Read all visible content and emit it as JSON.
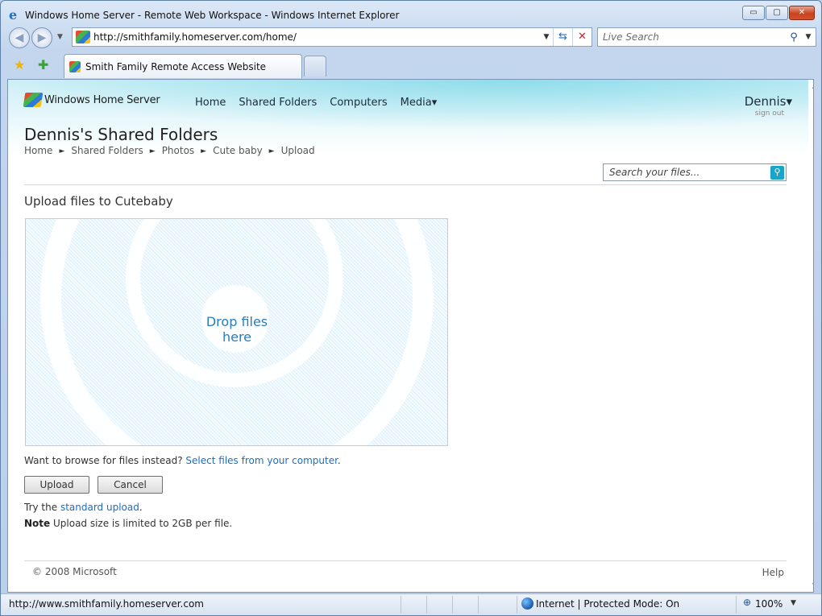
{
  "browser": {
    "window_title": "Windows Home Server - Remote Web Workspace - Windows Internet Explorer",
    "address": "http://smithfamily.homeserver.com/home/",
    "live_search_placeholder": "Live Search",
    "tab_title": "Smith Family Remote Access Website",
    "icons": [
      "ie-logo-icon",
      "back-icon",
      "forward-icon",
      "refresh-icon",
      "stop-icon",
      "search-icon",
      "favorites-star-icon",
      "add-favorite-icon",
      "site-icon",
      "globe-icon",
      "zoom-icon"
    ],
    "window_controls": {
      "minimize": "▭",
      "maximize": "▢",
      "close": "✕"
    }
  },
  "site": {
    "logo_text": "Windows Home Server",
    "nav": [
      "Home",
      "Shared Folders",
      "Computers",
      "Media▾"
    ],
    "user": "Dennis▾",
    "sign_out": "sign out",
    "page_title": "Dennis's Shared Folders",
    "breadcrumb": [
      "Home",
      "Shared Folders",
      "Photos",
      "Cute baby",
      "Upload"
    ],
    "breadcrumb_sep": "►",
    "search_placeholder": "Search your files..."
  },
  "upload": {
    "title": "Upload files to Cutebaby",
    "drop_text_1": "Drop files",
    "drop_text_2": "here",
    "browse_prefix": "Want to browse for files instead? ",
    "browse_link": "Select files from your computer",
    "browse_suffix": ".",
    "upload_button": "Upload",
    "cancel_button": "Cancel",
    "try_prefix": "Try the ",
    "try_link": "standard upload",
    "try_suffix": ".",
    "note_label": "Note",
    "note_text": " Upload size is limited to 2GB per file."
  },
  "footer": {
    "copyright": "© 2008 Microsoft",
    "help": "Help"
  },
  "status": {
    "url": "http://www.smithfamily.homeserver.com",
    "zone": "Internet | Protected Mode: On",
    "zoom": "100%"
  },
  "colors": {
    "link": "#1b6ec2",
    "accent_teal": "#18a5c7",
    "drop_zone": "#dff0fa"
  }
}
